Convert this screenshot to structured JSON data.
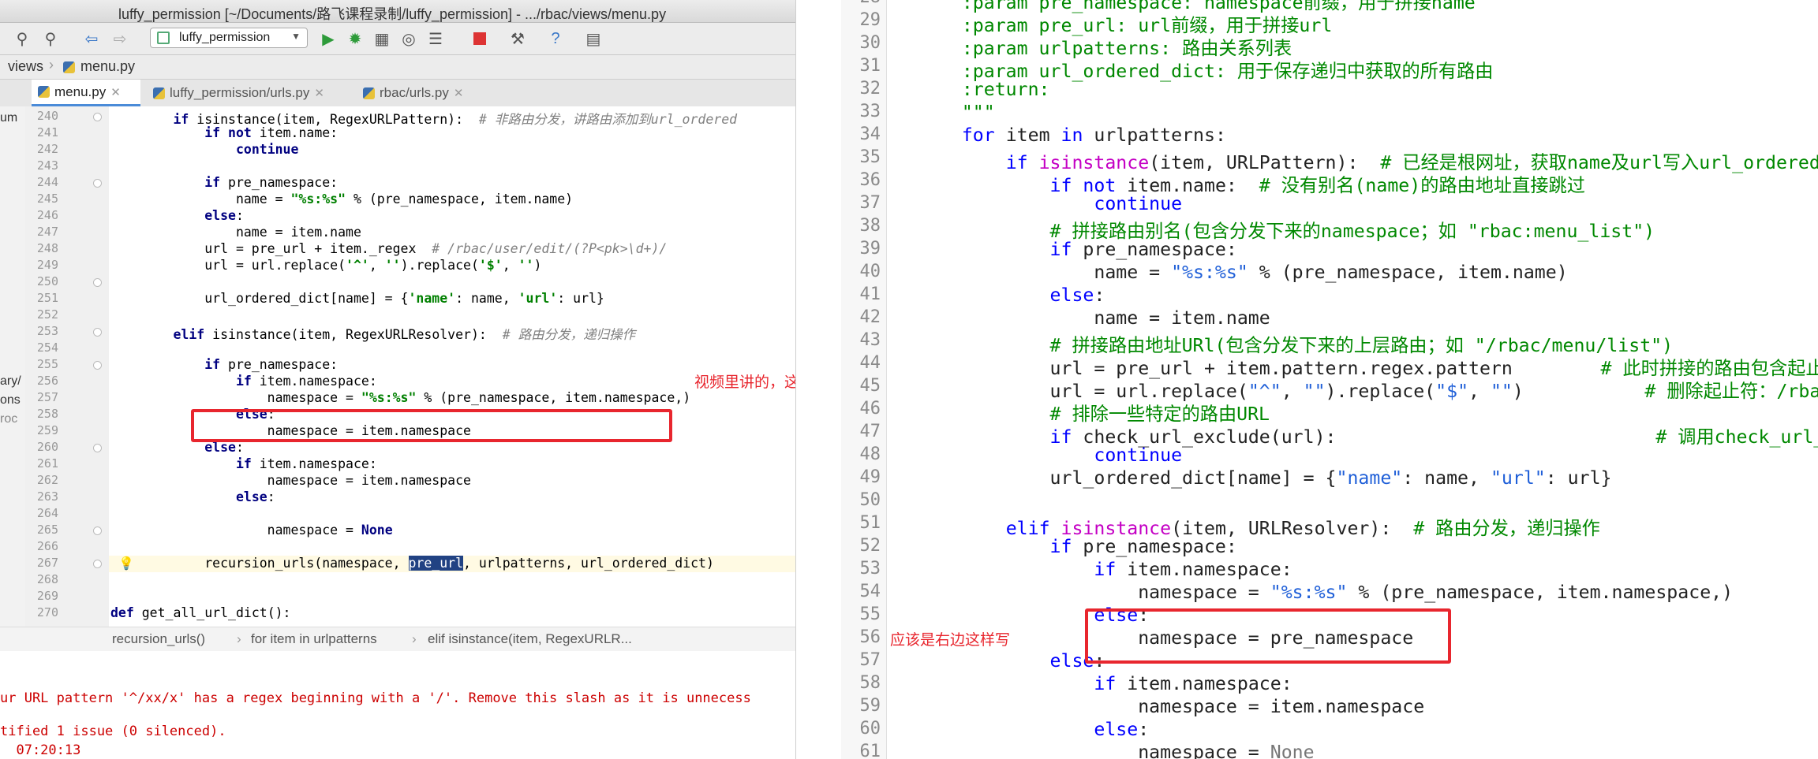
{
  "window": {
    "title": "luffy_permission [~/Documents/路飞课程录制/luffy_permission] - .../rbac/views/menu.py"
  },
  "toolbar": {
    "run_config": "luffy_permission"
  },
  "breadcrumb": {
    "folder": "views",
    "file": "menu.py"
  },
  "tabs": [
    {
      "label": "menu.py",
      "active": true
    },
    {
      "label": "luffy_permission/urls.py",
      "active": false
    },
    {
      "label": "rbac/urls.py",
      "active": false
    }
  ],
  "project_strip": [
    "um",
    "ary/",
    "ons",
    "roc"
  ],
  "left_editor": {
    "line_numbers": [
      "240",
      "241",
      "242",
      "243",
      "244",
      "245",
      "246",
      "247",
      "248",
      "249",
      "250",
      "251",
      "252",
      "253",
      "254",
      "255",
      "256",
      "257",
      "258",
      "259",
      "260",
      "261",
      "262",
      "263",
      "264",
      "265",
      "266",
      "267",
      "268",
      "269",
      "270"
    ],
    "lines": [
      "        if isinstance(item, RegexURLPattern):  # 非路由分发，讲路由添加到url_ordered",
      "            if not item.name:",
      "                continue",
      "",
      "            if pre_namespace:",
      "                name = \"%s:%s\" % (pre_namespace, item.name)",
      "            else:",
      "                name = item.name",
      "            url = pre_url + item._regex  # /rbac/user/edit/(?P<pk>\\d+)/",
      "            url = url.replace('^', '').replace('$', '')",
      "",
      "            url_ordered_dict[name] = {'name': name, 'url': url}",
      "",
      "        elif isinstance(item, RegexURLResolver):  # 路由分发，递归操作",
      "",
      "            if pre_namespace:",
      "                if item.namespace:",
      "                    namespace = \"%s:%s\" % (pre_namespace, item.namespace,)",
      "                else:",
      "                    namespace = item.namespace",
      "            else:",
      "                if item.namespace:",
      "                    namespace = item.namespace",
      "                else:",
      "",
      "                    namespace = None",
      "",
      "            recursion_urls(namespace, pre_url, urlpatterns, url_ordered_dict)",
      "",
      "",
      "def get_all_url_dict():"
    ]
  },
  "status_breadcrumb": [
    "recursion_urls()",
    "for item in urlpatterns",
    "elif isinstance(item, RegexURLR..."
  ],
  "console": {
    "lines": [
      "ur URL pattern '^/xx/x' has a regex beginning with a '/'. Remove this slash as it is unnecess",
      "tified 1 issue (0 silenced).",
      "  07:20:13"
    ]
  },
  "annotations": {
    "left_note": "视频里讲的，这行有问题",
    "right_note": "应该是右边这样写"
  },
  "right_editor": {
    "line_numbers": [
      "28",
      "29",
      "30",
      "31",
      "32",
      "33",
      "34",
      "35",
      "36",
      "37",
      "38",
      "39",
      "40",
      "41",
      "42",
      "43",
      "44",
      "45",
      "46",
      "47",
      "48",
      "49",
      "50",
      "51",
      "52",
      "53",
      "54",
      "55",
      "56",
      "57",
      "58",
      "59",
      "60",
      "61"
    ],
    "lines": [
      "    :param pre_namespace: namespace前缀，用于拼接name",
      "    :param pre_url: url前缀，用于拼接url",
      "    :param urlpatterns: 路由关系列表",
      "    :param url_ordered_dict: 用于保存递归中获取的所有路由",
      "    :return:",
      "    \"\"\"",
      "    for item in urlpatterns:",
      "        if isinstance(item, URLPattern):  # 已经是根网址，获取name及url写入url_ordered",
      "            if not item.name:  # 没有别名(name)的路由地址直接跳过",
      "                continue",
      "            # 拼接路由别名(包含分发下来的namespace；如 \"rbac:menu_list\")",
      "            if pre_namespace:",
      "                name = \"%s:%s\" % (pre_namespace, item.name)",
      "            else:",
      "                name = item.name",
      "            # 拼接路由地址URl(包含分发下来的上层路由；如 \"/rbac/menu/list\")",
      "            url = pre_url + item.pattern.regex.pattern        # 此时拼接的路由包含起止",
      "            url = url.replace(\"^\", \"\").replace(\"$\", \"\")           # 删除起止符：/rbac",
      "            # 排除一些特定的路由URL",
      "            if check_url_exclude(url):                             # 调用check_url_e",
      "                continue",
      "            url_ordered_dict[name] = {\"name\": name, \"url\": url}",
      "",
      "        elif isinstance(item, URLResolver):  # 路由分发，递归操作",
      "            if pre_namespace:",
      "                if item.namespace:",
      "                    namespace = \"%s:%s\" % (pre_namespace, item.namespace,)          #",
      "                else:",
      "                    namespace = pre_namespace",
      "            else:",
      "                if item.namespace:",
      "                    namespace = item.namespace",
      "                else:",
      "                    namespace = None"
    ]
  }
}
